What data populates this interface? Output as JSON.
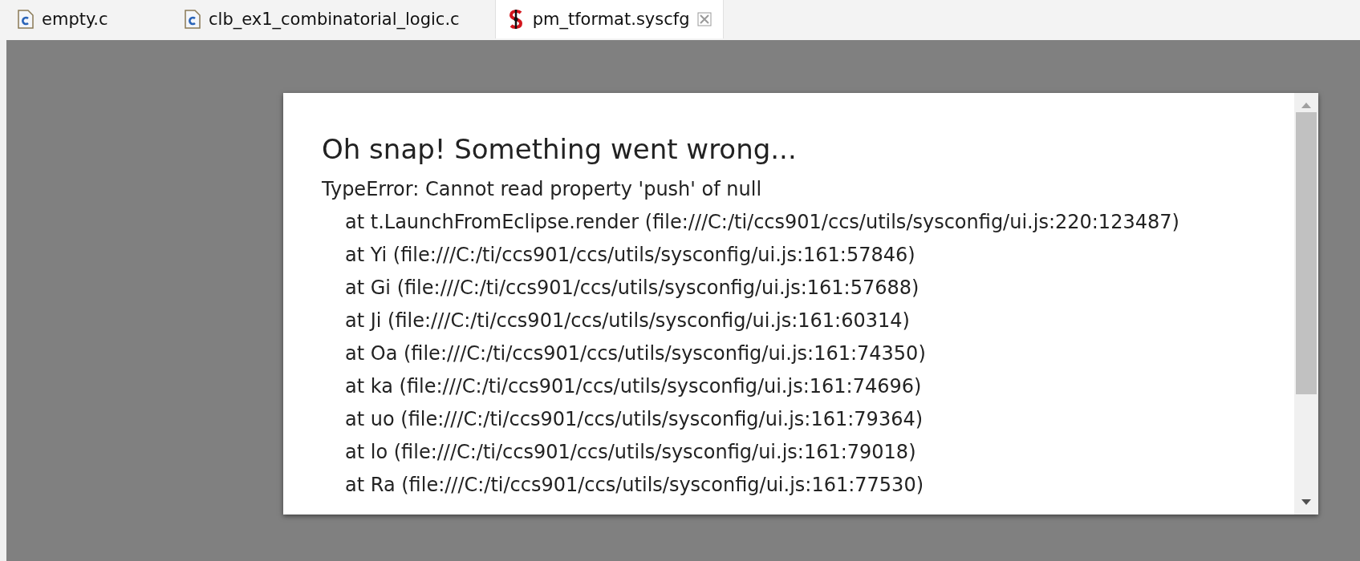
{
  "tabs": [
    {
      "label": "empty.c",
      "kind": "c",
      "selected": false
    },
    {
      "label": "clb_ex1_combinatorial_logic.c",
      "kind": "c",
      "selected": false
    },
    {
      "label": "pm_tformat.syscfg",
      "kind": "syscfg",
      "selected": true
    }
  ],
  "error": {
    "title": "Oh snap! Something went wrong...",
    "message": "TypeError: Cannot read property 'push' of null",
    "stack": [
      "at t.LaunchFromEclipse.render (file:///C:/ti/ccs901/ccs/utils/sysconfig/ui.js:220:123487)",
      "at Yi (file:///C:/ti/ccs901/ccs/utils/sysconfig/ui.js:161:57846)",
      "at Gi (file:///C:/ti/ccs901/ccs/utils/sysconfig/ui.js:161:57688)",
      "at Ji (file:///C:/ti/ccs901/ccs/utils/sysconfig/ui.js:161:60314)",
      "at Oa (file:///C:/ti/ccs901/ccs/utils/sysconfig/ui.js:161:74350)",
      "at ka (file:///C:/ti/ccs901/ccs/utils/sysconfig/ui.js:161:74696)",
      "at uo (file:///C:/ti/ccs901/ccs/utils/sysconfig/ui.js:161:79364)",
      "at lo (file:///C:/ti/ccs901/ccs/utils/sysconfig/ui.js:161:79018)",
      "at Ra (file:///C:/ti/ccs901/ccs/utils/sysconfig/ui.js:161:77530)"
    ]
  }
}
